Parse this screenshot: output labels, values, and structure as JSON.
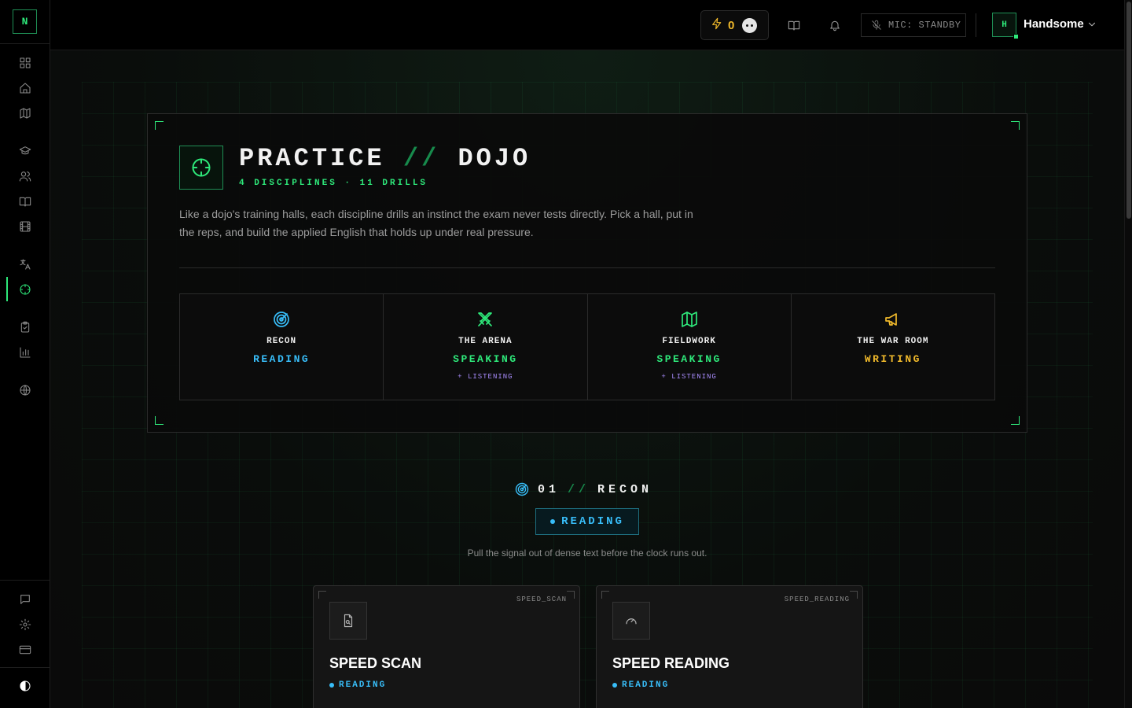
{
  "sidebar": {
    "logo": "N",
    "items": [
      {
        "name": "dashboard-icon"
      },
      {
        "name": "home-icon"
      },
      {
        "name": "map-icon"
      },
      {
        "name": "graduation-cap-icon"
      },
      {
        "name": "users-icon"
      },
      {
        "name": "book-icon"
      },
      {
        "name": "film-icon"
      },
      {
        "name": "translate-icon"
      },
      {
        "name": "crosshair-icon",
        "active": true
      },
      {
        "name": "clipboard-check-icon"
      },
      {
        "name": "bar-chart-icon"
      },
      {
        "name": "globe-icon"
      }
    ],
    "bottom": [
      {
        "name": "message-icon"
      },
      {
        "name": "gear-icon"
      },
      {
        "name": "credit-card-icon"
      }
    ],
    "theme": "contrast-icon"
  },
  "header": {
    "streak_count": "0",
    "mic_label": "MIC: STANDBY",
    "avatar_initial": "H",
    "username": "Handsome"
  },
  "hero": {
    "title_left": "PRACTICE",
    "title_sep": "//",
    "title_right": "DOJO",
    "subtitle": "4 DISCIPLINES · 11 DRILLS",
    "description": "Like a dojo's training halls, each discipline drills an instinct the exam never tests directly. Pick a hall, put in the reps, and build the applied English that holds up under real pressure.",
    "disciplines": [
      {
        "name": "RECON",
        "skill": "READING",
        "extra": "",
        "color": "#38bdf8",
        "icon": "radar-icon"
      },
      {
        "name": "THE ARENA",
        "skill": "SPEAKING",
        "extra": "+ LISTENING",
        "color": "#2ee87a",
        "icon": "swords-icon"
      },
      {
        "name": "FIELDWORK",
        "skill": "SPEAKING",
        "extra": "+ LISTENING",
        "color": "#2ee87a",
        "icon": "map-icon"
      },
      {
        "name": "THE WAR ROOM",
        "skill": "WRITING",
        "extra": "",
        "color": "#f0b92b",
        "icon": "megaphone-icon"
      }
    ]
  },
  "section": {
    "number": "01",
    "sep": "//",
    "name": "RECON",
    "badge": "READING",
    "description": "Pull the signal out of dense text before the clock runs out."
  },
  "cards": [
    {
      "tag": "SPEED_SCAN",
      "title": "SPEED SCAN",
      "skill": "READING",
      "icon": "file-search-icon"
    },
    {
      "tag": "SPEED_READING",
      "title": "SPEED READING",
      "skill": "READING",
      "icon": "gauge-icon"
    }
  ]
}
